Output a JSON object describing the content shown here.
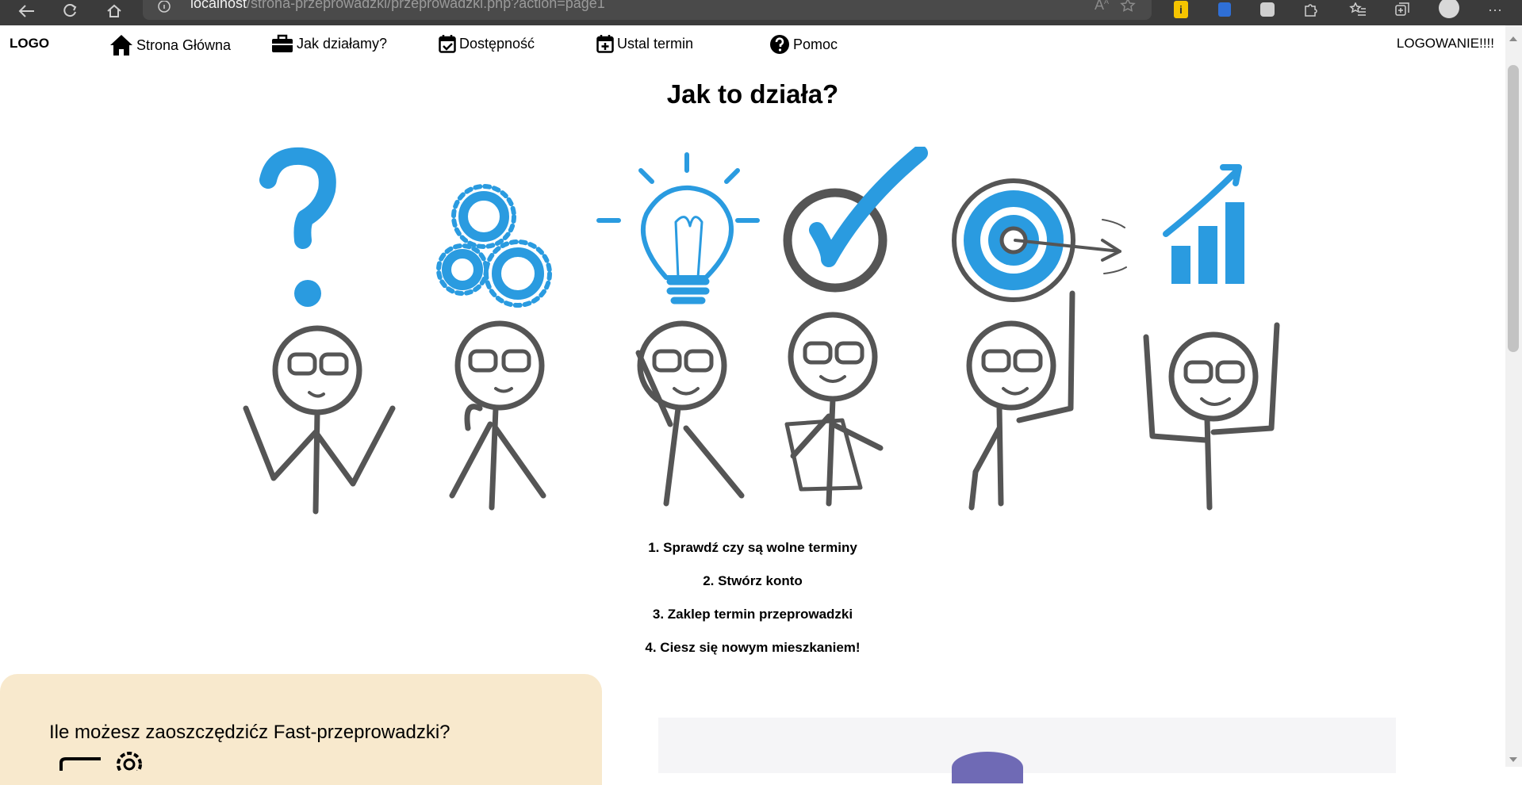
{
  "browser": {
    "url_host": "localhost",
    "url_path": "/strona-przeprowadzki/przeprowadzki.php?action=page1"
  },
  "nav": {
    "logo": "LOGO",
    "items": [
      {
        "label": "Strona Główna",
        "icon": "home-icon"
      },
      {
        "label": "Jak działamy?",
        "icon": "briefcase-icon"
      },
      {
        "label": "Dostępność",
        "icon": "calendar-check-icon"
      },
      {
        "label": "Ustal termin",
        "icon": "calendar-plus-icon"
      },
      {
        "label": "Pomoc",
        "icon": "question-circle-icon"
      }
    ],
    "login": "LOGOWANIE!!!!"
  },
  "main": {
    "title": "Jak to działa?",
    "steps": [
      "1. Sprawdź czy są wolne terminy",
      "2. Stwórz konto",
      "3. Zaklep termin przeprowadzki",
      "4. Ciesz się nowym mieszkaniem!"
    ]
  },
  "savings": {
    "question": "Ile możesz zaoszczędzićz Fast-przeprowadzki?"
  },
  "colors": {
    "accent_blue": "#2a9be0",
    "figure_gray": "#555555",
    "savings_bg": "#f8e9cd"
  }
}
